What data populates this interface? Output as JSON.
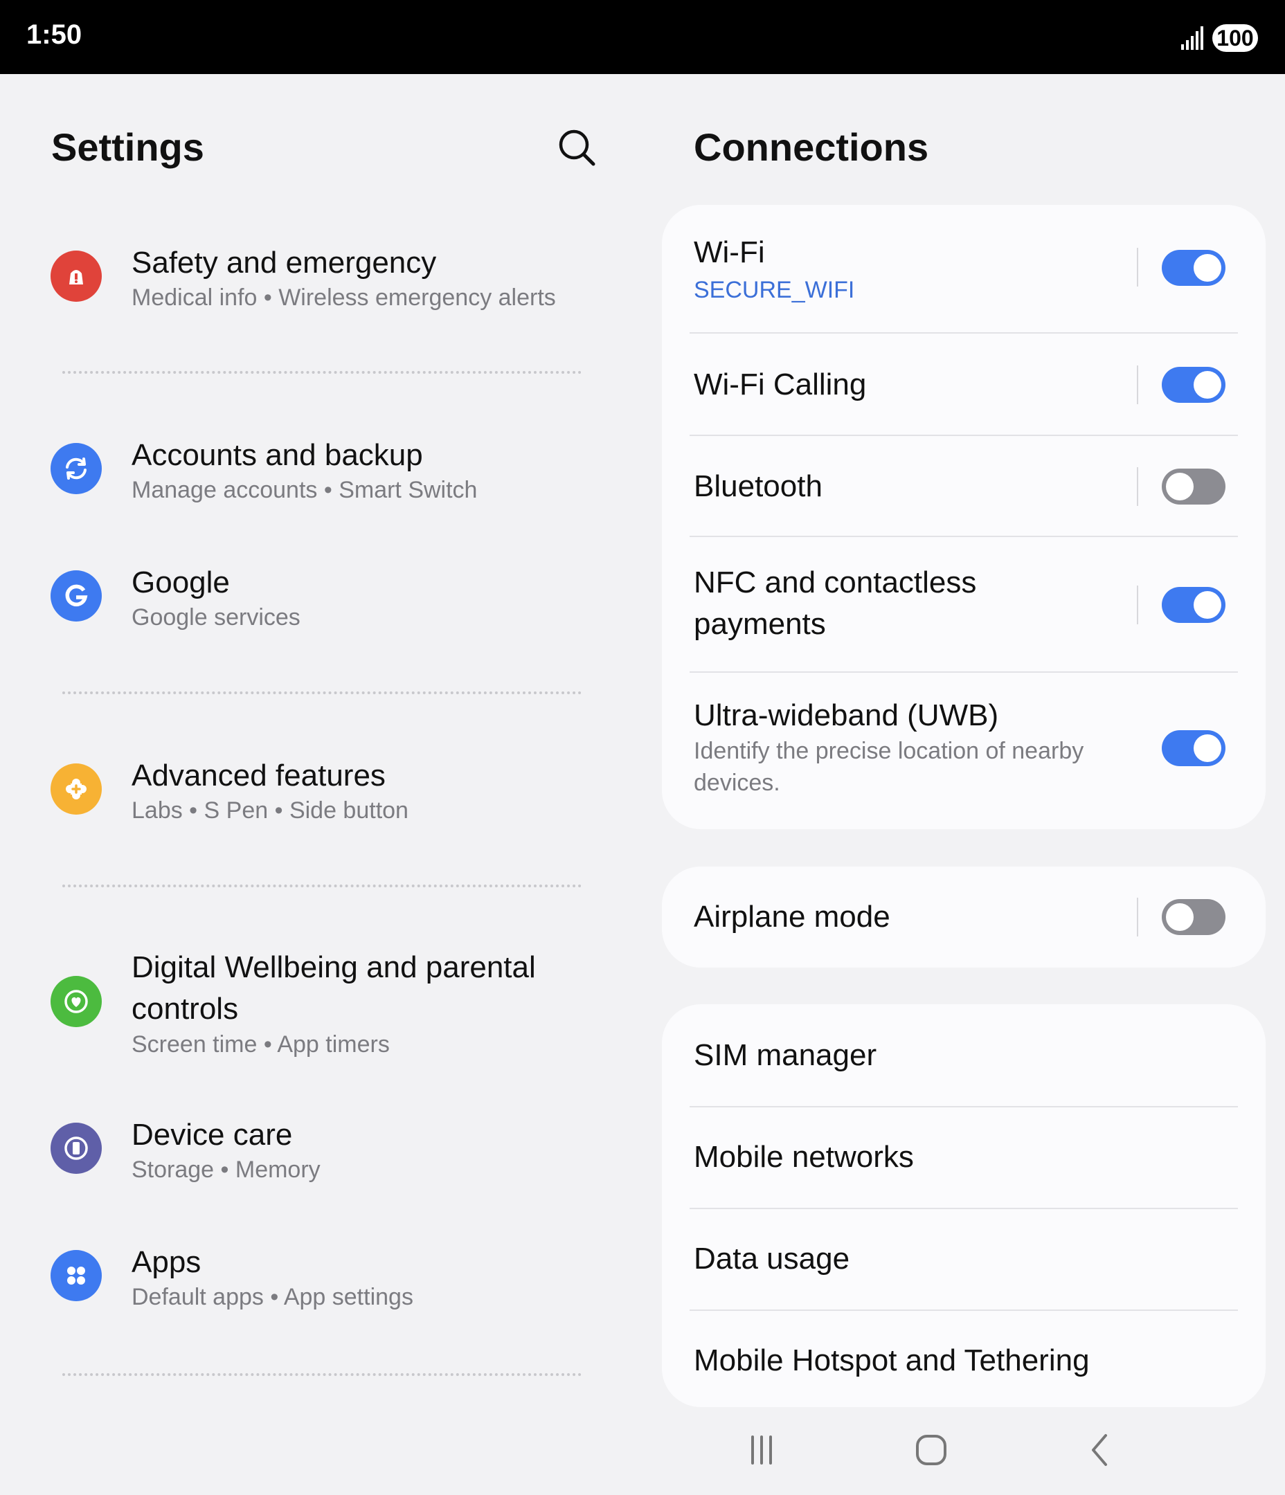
{
  "status": {
    "time": "1:50",
    "battery": "100"
  },
  "settings": {
    "title": "Settings",
    "items": [
      {
        "title": "Safety and emergency",
        "sub": "Medical info  •  Wireless emergency alerts",
        "color": "#e0433a",
        "icon": "siren-icon"
      },
      {
        "title": "Accounts and backup",
        "sub": "Manage accounts  •  Smart Switch",
        "color": "#3e7af0",
        "icon": "sync-icon"
      },
      {
        "title": "Google",
        "sub": "Google services",
        "color": "#3e7af0",
        "icon": "google-icon"
      },
      {
        "title": "Advanced features",
        "sub": "Labs  •  S Pen  •  Side button",
        "color": "#f7b234",
        "icon": "puzzle-icon"
      },
      {
        "title": "Digital Wellbeing and parental controls",
        "sub": "Screen time  •  App timers",
        "color": "#4cbb3f",
        "icon": "wellbeing-icon"
      },
      {
        "title": "Device care",
        "sub": "Storage  •  Memory",
        "color": "#5f5fa8",
        "icon": "device-care-icon"
      },
      {
        "title": "Apps",
        "sub": "Default apps  •  App settings",
        "color": "#3e7af0",
        "icon": "apps-icon"
      }
    ]
  },
  "connections": {
    "title": "Connections",
    "wifi": {
      "label": "Wi-Fi",
      "sub": "SECURE_WIFI",
      "on": true
    },
    "wifi_calling": {
      "label": "Wi-Fi Calling",
      "on": true
    },
    "bluetooth": {
      "label": "Bluetooth",
      "on": false
    },
    "nfc": {
      "label": "NFC and contactless payments",
      "on": true
    },
    "uwb": {
      "label": "Ultra-wideband (UWB)",
      "sub": "Identify the precise location of nearby devices.",
      "on": true
    },
    "airplane": {
      "label": "Airplane mode",
      "on": false
    },
    "sim_manager": {
      "label": "SIM manager"
    },
    "mobile_networks": {
      "label": "Mobile networks"
    },
    "data_usage": {
      "label": "Data usage"
    },
    "hotspot": {
      "label": "Mobile Hotspot and Tethering"
    }
  },
  "colors": {
    "accent": "#3e7af0",
    "toggle_off": "#8c8c92",
    "link": "#3b6fd8"
  }
}
